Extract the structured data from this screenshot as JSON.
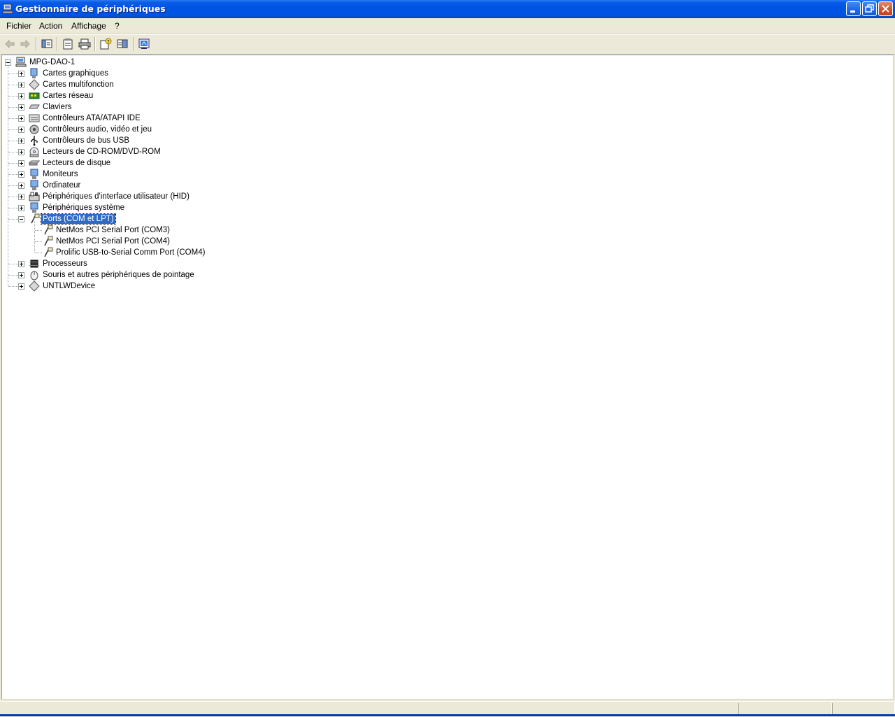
{
  "window": {
    "title": "Gestionnaire de périphériques"
  },
  "menu": {
    "items": [
      "Fichier",
      "Action",
      "Affichage",
      "?"
    ]
  },
  "toolbar": {
    "buttons": [
      "back-icon",
      "forward-icon",
      "show-hide-tree-icon",
      "properties-icon",
      "print-icon",
      "help-icon",
      "view-icon",
      "scan-hardware-icon"
    ]
  },
  "tree": {
    "root": "MPG-DAO-1",
    "categories": [
      {
        "label": "Cartes graphiques",
        "icon": "display-adapter-icon"
      },
      {
        "label": "Cartes multifonction",
        "icon": "multifunction-icon"
      },
      {
        "label": "Cartes réseau",
        "icon": "network-adapter-icon"
      },
      {
        "label": "Claviers",
        "icon": "keyboard-icon"
      },
      {
        "label": "Contrôleurs ATA/ATAPI IDE",
        "icon": "ide-controller-icon"
      },
      {
        "label": "Contrôleurs audio, vidéo et jeu",
        "icon": "audio-icon"
      },
      {
        "label": "Contrôleurs de bus USB",
        "icon": "usb-icon"
      },
      {
        "label": "Lecteurs de CD-ROM/DVD-ROM",
        "icon": "cdrom-icon"
      },
      {
        "label": "Lecteurs de disque",
        "icon": "disk-drive-icon"
      },
      {
        "label": "Moniteurs",
        "icon": "monitor-icon"
      },
      {
        "label": "Ordinateur",
        "icon": "computer-icon"
      },
      {
        "label": "Périphériques d'interface utilisateur (HID)",
        "icon": "hid-icon"
      },
      {
        "label": "Périphériques système",
        "icon": "system-device-icon"
      },
      {
        "label": "Ports (COM et LPT)",
        "icon": "port-icon",
        "expanded": true,
        "selected": true,
        "children": [
          "NetMos PCI Serial Port (COM3)",
          "NetMos PCI Serial Port (COM4)",
          "Prolific USB-to-Serial Comm Port (COM4)"
        ]
      },
      {
        "label": "Processeurs",
        "icon": "processor-icon"
      },
      {
        "label": "Souris et autres périphériques de pointage",
        "icon": "mouse-icon"
      },
      {
        "label": "UNTLWDevice",
        "icon": "unknown-device-icon"
      }
    ]
  },
  "colors": {
    "titlebar": "#0054e3",
    "selection": "#316ac5",
    "face": "#ece9d8"
  }
}
